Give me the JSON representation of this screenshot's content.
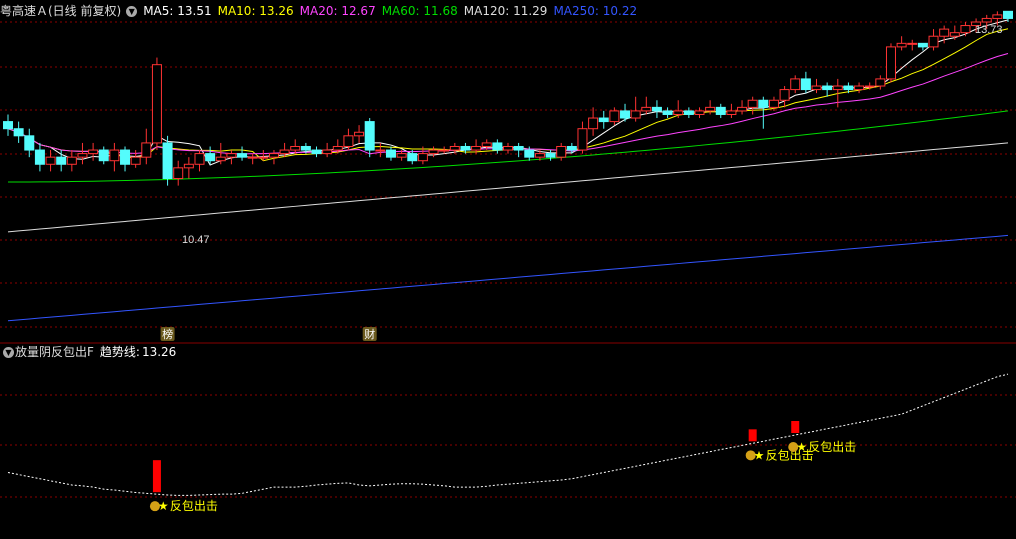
{
  "header": {
    "stock_title": "粤高速Ａ(日线 前复权)",
    "ma_values": [
      {
        "label": "MA5: 13.51",
        "color": "#ffffff"
      },
      {
        "label": "MA10: 13.26",
        "color": "#ffff00"
      },
      {
        "label": "MA20: 12.67",
        "color": "#ff44ff"
      },
      {
        "label": "MA60: 11.68",
        "color": "#00dd00"
      },
      {
        "label": "MA120: 11.29",
        "color": "#dddddd"
      },
      {
        "label": "MA250: 10.22",
        "color": "#3355ff"
      }
    ]
  },
  "price_panel": {
    "high_label": "13.73",
    "low_label": "10.47",
    "markers": [
      {
        "text": "榜",
        "bar_index": 15
      },
      {
        "text": "财",
        "bar_index": 34
      }
    ]
  },
  "indicator_panel": {
    "title": "放量阴反包出F",
    "trend_label": "趋势线:",
    "trend_value": "13.26",
    "signal_text": "反包出击",
    "signals": [
      {
        "bar_index": 14,
        "label": "反包出击"
      },
      {
        "bar_index": 70,
        "label": "反包出击"
      },
      {
        "bar_index": 74,
        "label": "反包出击"
      }
    ]
  },
  "colors": {
    "up": "#ff3333",
    "down": "#54fcfc",
    "grid": "#8b0000",
    "signal_bar": "#ff0000",
    "signal_text": "#ffff00",
    "trend_line": "#ffffff"
  },
  "chart_data": {
    "type": "candlestick",
    "series_names": [
      "MA5",
      "MA10",
      "MA20",
      "MA60",
      "MA120",
      "MA250"
    ],
    "ylim": [
      9.4,
      13.8
    ],
    "candles": [
      [
        12.4,
        12.3,
        12.5,
        12.2
      ],
      [
        12.3,
        12.2,
        12.4,
        12.1
      ],
      [
        12.2,
        12.0,
        12.3,
        11.9
      ],
      [
        12.0,
        11.8,
        12.1,
        11.7
      ],
      [
        11.8,
        11.9,
        12.0,
        11.7
      ],
      [
        11.9,
        11.8,
        12.0,
        11.7
      ],
      [
        11.8,
        11.9,
        12.0,
        11.7
      ],
      [
        11.9,
        11.95,
        12.1,
        11.8
      ],
      [
        11.95,
        12.0,
        12.1,
        11.85
      ],
      [
        12.0,
        11.85,
        12.05,
        11.8
      ],
      [
        11.85,
        12.0,
        12.1,
        11.7
      ],
      [
        12.0,
        11.8,
        12.05,
        11.7
      ],
      [
        11.8,
        11.9,
        12.0,
        11.75
      ],
      [
        11.9,
        12.1,
        12.3,
        11.8
      ],
      [
        12.1,
        13.2,
        13.3,
        12.0
      ],
      [
        12.1,
        11.6,
        12.2,
        11.5
      ],
      [
        11.6,
        11.75,
        11.85,
        11.5
      ],
      [
        11.75,
        11.8,
        11.9,
        11.6
      ],
      [
        11.8,
        11.95,
        12.0,
        11.7
      ],
      [
        11.95,
        11.85,
        12.05,
        11.8
      ],
      [
        11.85,
        11.9,
        12.1,
        11.8
      ],
      [
        11.9,
        11.95,
        12.0,
        11.8
      ],
      [
        11.95,
        11.9,
        12.05,
        11.85
      ],
      [
        11.9,
        11.9,
        11.95,
        11.8
      ],
      [
        11.9,
        11.9,
        12.0,
        11.85
      ],
      [
        11.9,
        11.95,
        12.0,
        11.8
      ],
      [
        11.95,
        12.0,
        12.1,
        11.9
      ],
      [
        12.0,
        12.05,
        12.15,
        11.95
      ],
      [
        12.05,
        12.0,
        12.1,
        11.95
      ],
      [
        12.0,
        11.95,
        12.05,
        11.9
      ],
      [
        11.95,
        12.0,
        12.1,
        11.9
      ],
      [
        12.0,
        12.05,
        12.15,
        11.95
      ],
      [
        12.05,
        12.2,
        12.3,
        12.0
      ],
      [
        12.2,
        12.25,
        12.35,
        12.1
      ],
      [
        12.4,
        12.0,
        12.45,
        11.9
      ],
      [
        12.0,
        12.0,
        12.1,
        11.9
      ],
      [
        12.0,
        11.9,
        12.05,
        11.85
      ],
      [
        11.9,
        11.95,
        12.0,
        11.85
      ],
      [
        11.95,
        11.85,
        12.0,
        11.8
      ],
      [
        11.85,
        11.95,
        12.05,
        11.8
      ],
      [
        11.95,
        12.0,
        12.05,
        11.9
      ],
      [
        12.0,
        12.0,
        12.05,
        11.95
      ],
      [
        12.0,
        12.05,
        12.1,
        11.95
      ],
      [
        12.05,
        12.0,
        12.1,
        11.95
      ],
      [
        12.0,
        12.05,
        12.15,
        11.95
      ],
      [
        12.05,
        12.1,
        12.15,
        12.0
      ],
      [
        12.1,
        12.0,
        12.15,
        11.95
      ],
      [
        12.0,
        12.05,
        12.1,
        11.95
      ],
      [
        12.05,
        12.0,
        12.1,
        11.9
      ],
      [
        12.0,
        11.9,
        12.05,
        11.85
      ],
      [
        11.9,
        11.95,
        12.0,
        11.85
      ],
      [
        11.95,
        11.9,
        12.0,
        11.85
      ],
      [
        11.9,
        12.05,
        12.1,
        11.85
      ],
      [
        12.05,
        12.0,
        12.1,
        11.95
      ],
      [
        12.0,
        12.3,
        12.4,
        11.95
      ],
      [
        12.3,
        12.45,
        12.6,
        12.2
      ],
      [
        12.45,
        12.4,
        12.55,
        12.3
      ],
      [
        12.4,
        12.55,
        12.6,
        12.35
      ],
      [
        12.55,
        12.45,
        12.65,
        12.4
      ],
      [
        12.45,
        12.55,
        12.75,
        12.4
      ],
      [
        12.55,
        12.6,
        12.75,
        12.5
      ],
      [
        12.6,
        12.55,
        12.7,
        12.45
      ],
      [
        12.55,
        12.5,
        12.6,
        12.45
      ],
      [
        12.5,
        12.55,
        12.7,
        12.45
      ],
      [
        12.55,
        12.5,
        12.6,
        12.45
      ],
      [
        12.5,
        12.55,
        12.6,
        12.45
      ],
      [
        12.55,
        12.6,
        12.7,
        12.5
      ],
      [
        12.6,
        12.5,
        12.65,
        12.45
      ],
      [
        12.5,
        12.55,
        12.65,
        12.45
      ],
      [
        12.55,
        12.6,
        12.7,
        12.5
      ],
      [
        12.6,
        12.7,
        12.75,
        12.5
      ],
      [
        12.7,
        12.6,
        12.75,
        12.3
      ],
      [
        12.6,
        12.7,
        12.75,
        12.55
      ],
      [
        12.7,
        12.85,
        12.9,
        12.6
      ],
      [
        12.85,
        13.0,
        13.05,
        12.8
      ],
      [
        13.0,
        12.85,
        13.1,
        12.8
      ],
      [
        12.85,
        12.9,
        13.0,
        12.8
      ],
      [
        12.9,
        12.85,
        12.95,
        12.75
      ],
      [
        12.85,
        12.9,
        13.0,
        12.6
      ],
      [
        12.9,
        12.85,
        12.95,
        12.8
      ],
      [
        12.85,
        12.9,
        12.95,
        12.8
      ],
      [
        12.9,
        12.9,
        12.95,
        12.85
      ],
      [
        12.9,
        13.0,
        13.05,
        12.85
      ],
      [
        13.0,
        13.45,
        13.5,
        12.95
      ],
      [
        13.45,
        13.5,
        13.6,
        13.4
      ],
      [
        13.5,
        13.5,
        13.55,
        13.4
      ],
      [
        13.5,
        13.45,
        13.5,
        13.4
      ],
      [
        13.45,
        13.6,
        13.7,
        13.4
      ],
      [
        13.6,
        13.7,
        13.75,
        13.5
      ],
      [
        13.6,
        13.65,
        13.75,
        13.55
      ],
      [
        13.65,
        13.75,
        13.8,
        13.6
      ],
      [
        13.75,
        13.8,
        13.85,
        13.65
      ],
      [
        13.8,
        13.85,
        13.9,
        13.7
      ],
      [
        13.85,
        13.9,
        13.95,
        13.75
      ],
      [
        13.95,
        13.85,
        13.95,
        13.8
      ]
    ],
    "trend_line": [
      10.9,
      10.85,
      10.8,
      10.75,
      10.7,
      10.65,
      10.6,
      10.58,
      10.55,
      10.5,
      10.48,
      10.45,
      10.42,
      10.4,
      10.38,
      10.36,
      10.35,
      10.35,
      10.36,
      10.37,
      10.38,
      10.38,
      10.4,
      10.45,
      10.5,
      10.55,
      10.55,
      10.55,
      10.57,
      10.6,
      10.62,
      10.64,
      10.65,
      10.6,
      10.58,
      10.6,
      10.62,
      10.63,
      10.63,
      10.62,
      10.6,
      10.58,
      10.55,
      10.55,
      10.55,
      10.57,
      10.6,
      10.62,
      10.64,
      10.66,
      10.68,
      10.7,
      10.72,
      10.75,
      10.8,
      10.85,
      10.9,
      10.95,
      11.0,
      11.05,
      11.1,
      11.15,
      11.2,
      11.25,
      11.3,
      11.35,
      11.4,
      11.45,
      11.5,
      11.55,
      11.6,
      11.65,
      11.7,
      11.75,
      11.8,
      11.85,
      11.9,
      11.95,
      12.0,
      12.05,
      12.1,
      12.15,
      12.2,
      12.25,
      12.3,
      12.4,
      12.5,
      12.6,
      12.7,
      12.8,
      12.9,
      13.0,
      13.1,
      13.2,
      13.26
    ]
  }
}
